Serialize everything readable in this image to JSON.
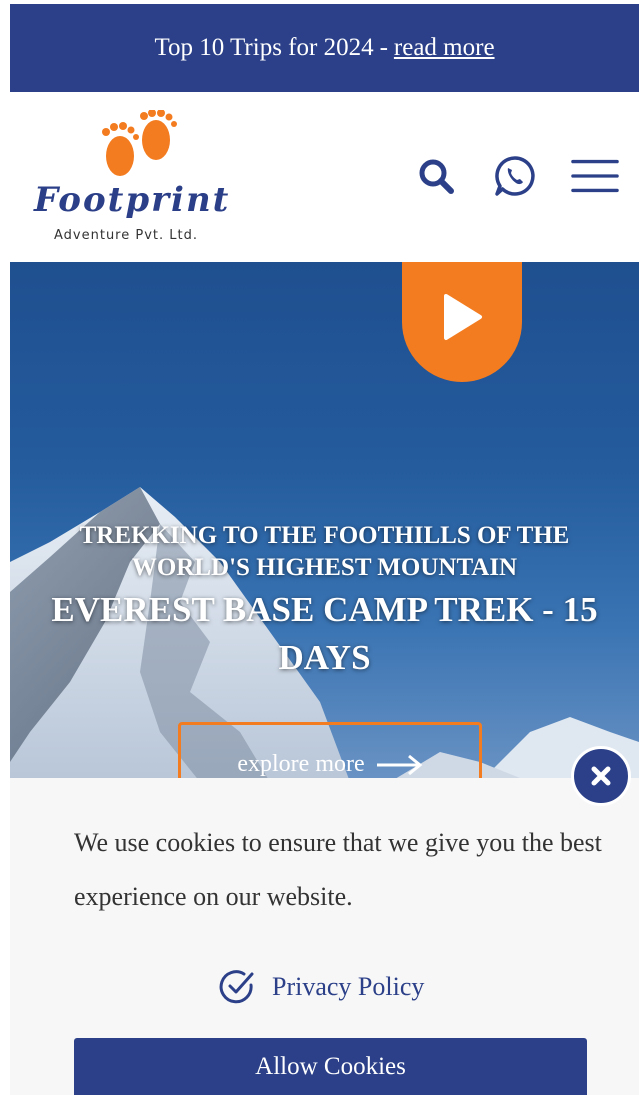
{
  "announcement": {
    "text": "Top 10 Trips for 2024",
    "separator": "-",
    "link_label": "read more"
  },
  "logo": {
    "name": "Footprint",
    "subtitle": "Adventure Pvt. Ltd."
  },
  "header_icons": [
    "search-icon",
    "whatsapp-icon",
    "hamburger-menu-icon"
  ],
  "hero": {
    "eyebrow": "TREKKING TO THE FOOTHILLS OF THE WORLD'S HIGHEST MOUNTAIN",
    "title": "EVEREST BASE CAMP TREK - 15 DAYS",
    "explore_label": "explore more",
    "play_icon": "play-icon"
  },
  "cookie": {
    "message": "We use cookies to ensure that we give you the best experience on our website.",
    "privacy_label": "Privacy Policy",
    "allow_label": "Allow Cookies",
    "close_icon": "close-icon"
  },
  "colors": {
    "brand_blue": "#2b4088",
    "accent_orange": "#f47c20",
    "banner_bg": "#f7f7f7"
  }
}
